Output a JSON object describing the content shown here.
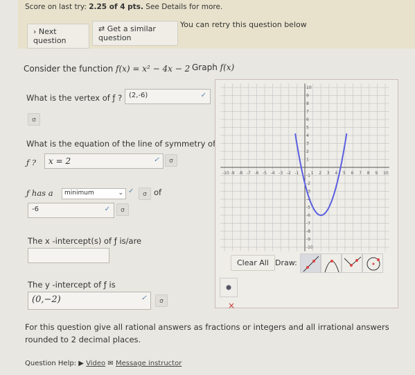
{
  "banner": {
    "score_prefix": "Score on last try: ",
    "score": "2.25 of 4 pts.",
    "score_suffix": " See Details for more.",
    "next": "Next question",
    "similar": "Get a similar question",
    "retry": "You can retry this question below"
  },
  "question": {
    "intro": "Consider the function",
    "func": "f(x) = x² − 4x − 2",
    "graph_label": "Graph",
    "graph_f": "f(x)",
    "q1": "What is the vertex of ƒ ?",
    "a1": "(2,-6)",
    "q2a": "What is the equation of the line of symmetry of",
    "q2b": "ƒ ?",
    "a2": "x = 2",
    "q3a": "ƒ  has a",
    "a3_select": "minimum",
    "q3b": "of",
    "a3": "-6",
    "q4": "The x -intercept(s) of ƒ  is/are",
    "a4": "",
    "q5": "The y -intercept of ƒ  is",
    "a5": "(0,−2)",
    "key_icon": "σ"
  },
  "graph": {
    "xrange": [
      -10,
      10
    ],
    "yrange": [
      -10,
      10
    ],
    "curve": {
      "a": 1,
      "b": -4,
      "c": -2
    },
    "curve_color": "#5a5ee0",
    "clear": "Clear All",
    "draw": "Draw:",
    "tools": [
      "line-tool",
      "parabola-tool",
      "absolute-value-tool",
      "circle-tool",
      "point-tool"
    ],
    "delete": "×"
  },
  "footer": {
    "note": "For this question give all rational answers as fractions or integers and all irrational answers rounded to 2 decimal places.",
    "help": "Question Help:",
    "video": "Video",
    "message": "Message instructor"
  }
}
